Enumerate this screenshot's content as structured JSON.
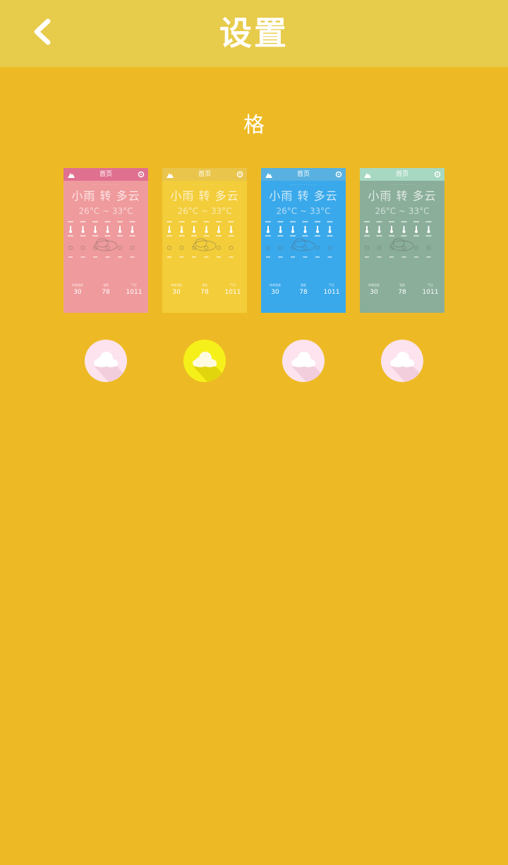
{
  "header": {
    "title": "设置"
  },
  "section": {
    "title": "格"
  },
  "colors": {
    "background": "#EDBA25",
    "topbar": "#E7CB4A",
    "button_default": "#FCE3EE",
    "button_selected": "#F6F01A"
  },
  "theme_preview": {
    "city": "首页",
    "condition": "小雨 转 多云",
    "temperature": "26°C ~ 33°C",
    "stats": [
      {
        "label": "体感温度",
        "value": "30"
      },
      {
        "label": "湿度",
        "value": "78"
      },
      {
        "label": "气压",
        "value": "1011"
      }
    ]
  },
  "themes": [
    {
      "name": "pink",
      "header_color": "#E0708F",
      "body_color": "#EF9A9C",
      "selected": false
    },
    {
      "name": "yellow",
      "header_color": "#E9C54C",
      "body_color": "#F3CD3A",
      "selected": true
    },
    {
      "name": "blue",
      "header_color": "#58B1E0",
      "body_color": "#3AA9EB",
      "selected": false
    },
    {
      "name": "green",
      "header_color": "#A7D8C1",
      "body_color": "#8AAE9A",
      "selected": false
    }
  ],
  "icons": {
    "back": "chevron-left-icon",
    "theme_button": "cloud-icon",
    "card_left": "mountain-icon",
    "card_right": "gear-icon"
  }
}
